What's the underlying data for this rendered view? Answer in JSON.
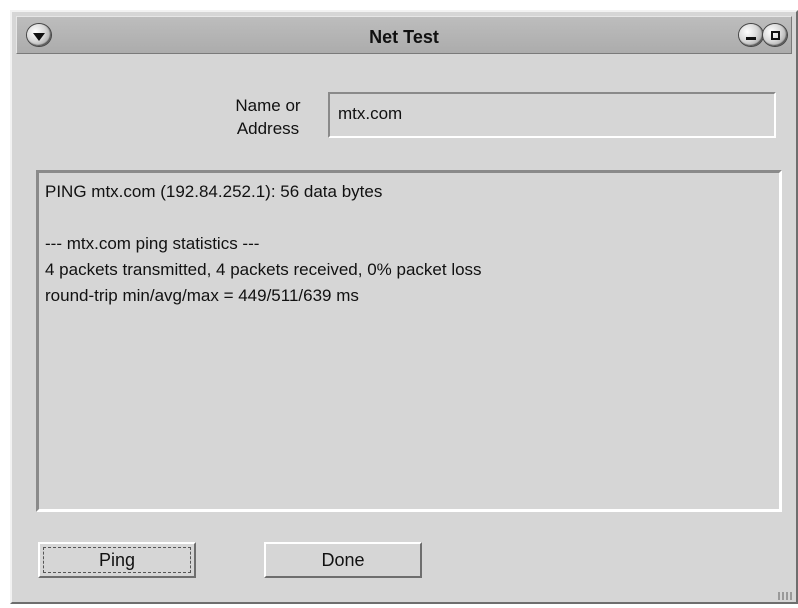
{
  "window": {
    "title": "Net Test",
    "menu_icon": "chevron-down-icon",
    "minimize_icon": "minimize-icon",
    "maximize_icon": "maximize-icon"
  },
  "form": {
    "name_label": "Name or\nAddress",
    "address_value": "mtx.com"
  },
  "output": {
    "lines": [
      "PING mtx.com (192.84.252.1): 56 data bytes",
      "",
      "--- mtx.com ping statistics ---",
      "4 packets transmitted, 4 packets received, 0% packet loss",
      "round-trip min/avg/max = 449/511/639 ms"
    ]
  },
  "buttons": {
    "ping_label": "Ping",
    "done_label": "Done"
  }
}
